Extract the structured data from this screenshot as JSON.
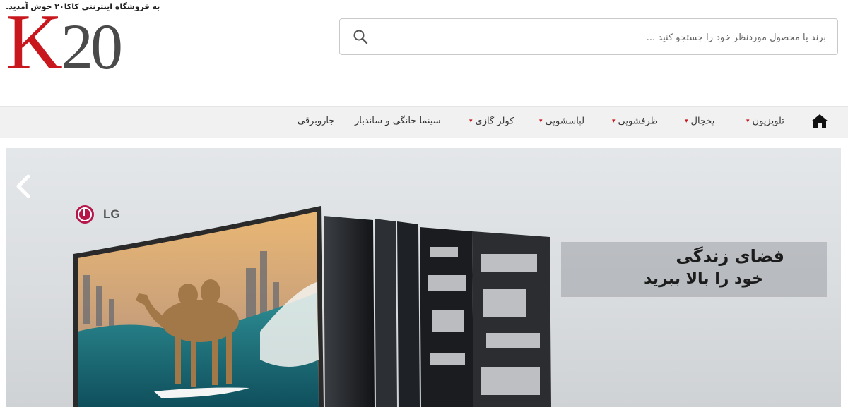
{
  "header": {
    "welcome": "به فروشگاه اینترنتی کاکا۲۰ خوش آمدید.",
    "logo": {
      "letter": "K",
      "number": "20"
    }
  },
  "search": {
    "placeholder": "برند یا محصول موردنظر خود را جستجو کنید ...",
    "icon": "search-icon"
  },
  "nav": {
    "home_icon": "home-icon",
    "items": [
      {
        "label": "تلویزیون",
        "has_dropdown": true
      },
      {
        "label": "یخچال",
        "has_dropdown": true
      },
      {
        "label": "ظرفشویی",
        "has_dropdown": true
      },
      {
        "label": "لباسشویی",
        "has_dropdown": true
      },
      {
        "label": "کولر گازی",
        "has_dropdown": true
      },
      {
        "label": "سینما خانگی و ساندبار",
        "has_dropdown": false
      },
      {
        "label": "جاروبرقی",
        "has_dropdown": false
      }
    ],
    "chevron": "▾"
  },
  "banner": {
    "brand": "LG",
    "tagline_line1": "فضای زندگی",
    "tagline_line2": "خود را بالا ببرید",
    "prev_icon": "chevron-left-icon"
  },
  "colors": {
    "brand_red": "#c8181e",
    "logo_gray": "#4a4a4a",
    "nav_bg": "#f1f1f1"
  }
}
